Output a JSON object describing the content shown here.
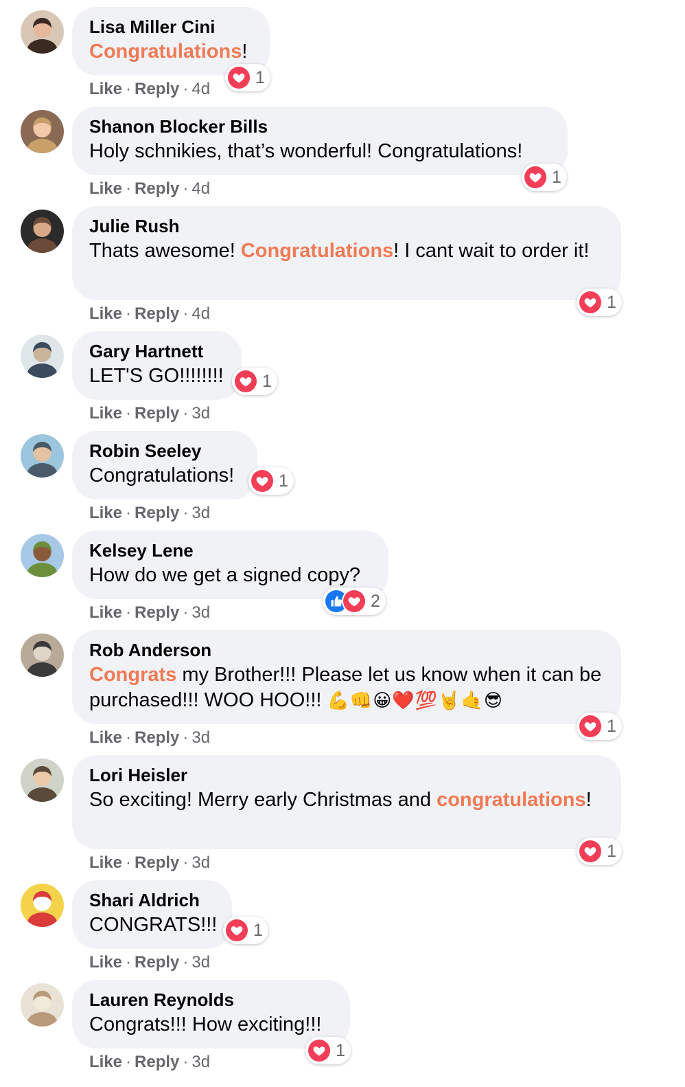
{
  "comments": [
    {
      "author": "Lisa Miller Cini",
      "text": [
        {
          "t": "Congratulations",
          "h": true
        },
        {
          "t": "!"
        }
      ],
      "time": "4d",
      "reaction_count": "1",
      "reactions": [
        "heart"
      ]
    },
    {
      "author": "Shanon Blocker Bills",
      "text": [
        {
          "t": "Holy schnikies, that’s wonderful! Congratulations!"
        }
      ],
      "time": "4d",
      "reaction_count": "1",
      "reactions": [
        "heart"
      ]
    },
    {
      "author": "Julie Rush",
      "text": [
        {
          "t": "Thats awesome! "
        },
        {
          "t": "Congratulations",
          "h": true
        },
        {
          "t": "! I cant wait to order it!"
        }
      ],
      "time": "4d",
      "reaction_count": "1",
      "reactions": [
        "heart"
      ]
    },
    {
      "author": "Gary Hartnett",
      "text": [
        {
          "t": "LET'S GO!!!!!!!!"
        }
      ],
      "time": "3d",
      "reaction_count": "1",
      "reactions": [
        "heart"
      ]
    },
    {
      "author": "Robin Seeley",
      "text": [
        {
          "t": "Congratulations!"
        }
      ],
      "time": "3d",
      "reaction_count": "1",
      "reactions": [
        "heart"
      ]
    },
    {
      "author": "Kelsey Lene",
      "text": [
        {
          "t": "How do we get a signed copy?"
        }
      ],
      "time": "3d",
      "reaction_count": "2",
      "reactions": [
        "like",
        "heart"
      ]
    },
    {
      "author": "Rob Anderson",
      "text": [
        {
          "t": "Congrats",
          "h": true
        },
        {
          "t": " my Brother!!! Please let us know when it can be purchased!!! WOO HOO!!! "
        },
        {
          "t": "💪👊😀❤️💯🤘🤙😎",
          "e": true
        }
      ],
      "time": "3d",
      "reaction_count": "1",
      "reactions": [
        "heart"
      ]
    },
    {
      "author": "Lori Heisler",
      "text": [
        {
          "t": "So exciting! Merry early Christmas and "
        },
        {
          "t": "congratulations",
          "h": true
        },
        {
          "t": "!"
        }
      ],
      "time": "3d",
      "reaction_count": "1",
      "reactions": [
        "heart"
      ]
    },
    {
      "author": "Shari Aldrich",
      "text": [
        {
          "t": "CONGRATS!!!"
        }
      ],
      "time": "3d",
      "reaction_count": "1",
      "reactions": [
        "heart"
      ]
    },
    {
      "author": "Lauren Reynolds",
      "text": [
        {
          "t": "Congrats!!! How exciting!!!"
        }
      ],
      "time": "3d",
      "reaction_count": "1",
      "reactions": [
        "heart"
      ]
    }
  ],
  "labels": {
    "like": "Like",
    "reply": "Reply",
    "dot": "·"
  },
  "colors": {
    "highlight": "#f07a55",
    "bubble": "#f0f2f5",
    "heart": "#f33e58",
    "like": "#1877f2",
    "meta": "#65676b"
  },
  "icons": {
    "heart": "heart-icon",
    "like": "thumbs-up-icon"
  }
}
